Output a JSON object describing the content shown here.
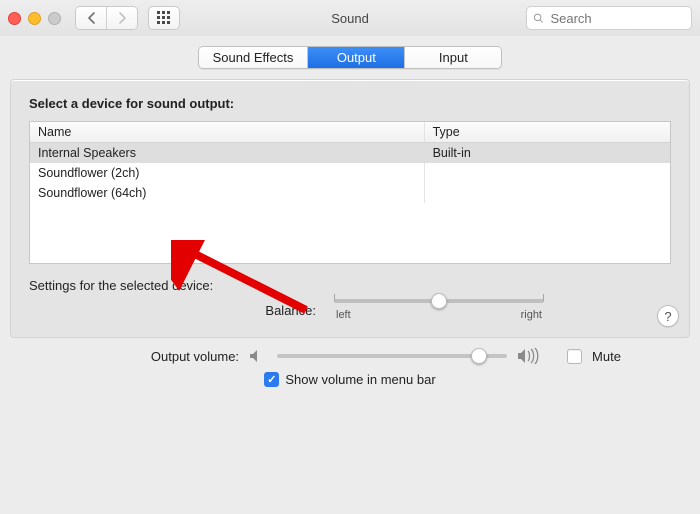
{
  "window": {
    "title": "Sound",
    "search_placeholder": "Search"
  },
  "tabs": {
    "sound_effects": "Sound Effects",
    "output": "Output",
    "input": "Input",
    "active": "output"
  },
  "panel": {
    "heading": "Select a device for sound output:",
    "columns": {
      "name": "Name",
      "type": "Type"
    },
    "devices": [
      {
        "name": "Internal Speakers",
        "type": "Built-in",
        "selected": true
      },
      {
        "name": "Soundflower (2ch)",
        "type": "",
        "selected": false
      },
      {
        "name": "Soundflower (64ch)",
        "type": "",
        "selected": false
      }
    ],
    "settings_label": "Settings for the selected device:",
    "balance": {
      "label": "Balance:",
      "left": "left",
      "right": "right",
      "value": 0.5
    },
    "help_label": "?"
  },
  "footer": {
    "volume_label": "Output volume:",
    "mute_label": "Mute",
    "mute_checked": false,
    "show_in_menubar_label": "Show volume in menu bar",
    "show_in_menubar_checked": true,
    "volume_value": 0.88
  },
  "annotation": {
    "kind": "red-arrow",
    "target": "Soundflower (2ch)"
  }
}
